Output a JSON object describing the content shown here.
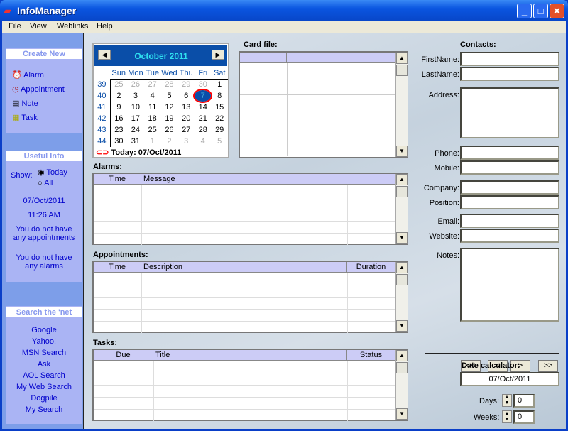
{
  "window": {
    "title": "InfoManager",
    "minimize": "_",
    "maximize": "□",
    "close": "✕"
  },
  "menu": [
    "File",
    "View",
    "Weblinks",
    "Help"
  ],
  "sidebar": {
    "create_new": {
      "title": "Create New",
      "items": [
        {
          "label": "Alarm",
          "icon": "alarm-clock-icon"
        },
        {
          "label": "Appointment",
          "icon": "clock-icon"
        },
        {
          "label": "Note",
          "icon": "note-icon"
        },
        {
          "label": "Task",
          "icon": "task-list-icon"
        }
      ]
    },
    "useful_info": {
      "title": "Useful Info",
      "show_label": "Show:",
      "options": [
        "Today",
        "All"
      ],
      "selected": "Today",
      "date": "07/Oct/2011",
      "time": "11:26 AM",
      "no_appointments": "You do not have any appointments",
      "no_alarms": "You do not have any alarms"
    },
    "search": {
      "title": "Search the 'net",
      "links": [
        "Google",
        "Yahoo!",
        "MSN Search",
        "Ask",
        "AOL Search",
        "My Web Search",
        "Dogpile",
        "My Search"
      ]
    }
  },
  "calendar": {
    "month": "October 2011",
    "days": [
      "Sun",
      "Mon",
      "Tue",
      "Wed",
      "Thu",
      "Fri",
      "Sat"
    ],
    "weeks": [
      {
        "wk": "39",
        "d": [
          "25",
          "26",
          "27",
          "28",
          "29",
          "30",
          "1"
        ]
      },
      {
        "wk": "40",
        "d": [
          "2",
          "3",
          "4",
          "5",
          "6",
          "7",
          "8"
        ]
      },
      {
        "wk": "41",
        "d": [
          "9",
          "10",
          "11",
          "12",
          "13",
          "14",
          "15"
        ]
      },
      {
        "wk": "42",
        "d": [
          "16",
          "17",
          "18",
          "19",
          "20",
          "21",
          "22"
        ]
      },
      {
        "wk": "43",
        "d": [
          "23",
          "24",
          "25",
          "26",
          "27",
          "28",
          "29"
        ]
      },
      {
        "wk": "44",
        "d": [
          "30",
          "31",
          "1",
          "2",
          "3",
          "4",
          "5"
        ]
      }
    ],
    "selected": "7",
    "today": "Today: 07/Oct/2011",
    "accent": "#0a4ea8"
  },
  "cardfile": {
    "label": "Card file:"
  },
  "alarms": {
    "label": "Alarms:",
    "columns": [
      "Time",
      "Message"
    ]
  },
  "appointments": {
    "label": "Appointments:",
    "columns": [
      "Time",
      "Description",
      "Duration"
    ]
  },
  "tasks": {
    "label": "Tasks:",
    "columns": [
      "Due",
      "Title",
      "Status"
    ]
  },
  "contacts": {
    "title": "Contacts:",
    "fields": {
      "firstname": "FirstName:",
      "lastname": "LastName:",
      "address": "Address:",
      "phone": "Phone:",
      "mobile": "Mobile:",
      "company": "Company:",
      "position": "Position:",
      "email": "Email:",
      "website": "Website:",
      "notes": "Notes:"
    },
    "nav": [
      "<<",
      "<",
      ">",
      ">>"
    ]
  },
  "datecalc": {
    "title": "Date calculator:",
    "date": "07/Oct/2011",
    "days_label": "Days:",
    "days": "0",
    "weeks_label": "Weeks:",
    "weeks": "0"
  }
}
